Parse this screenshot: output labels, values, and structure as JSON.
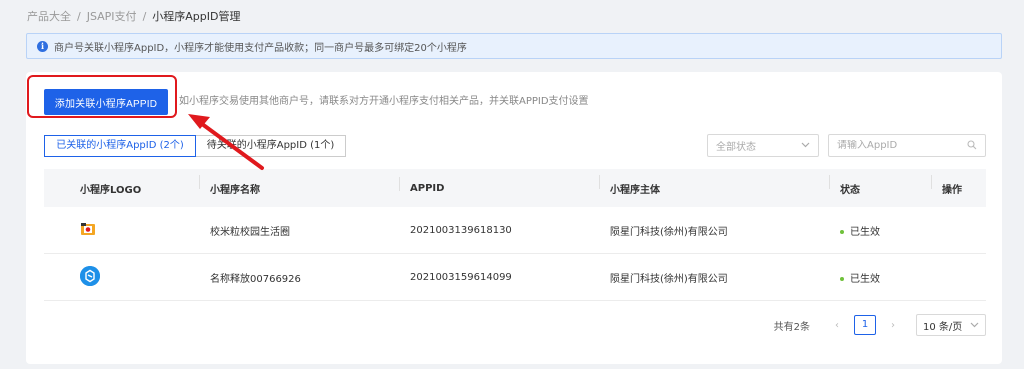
{
  "breadcrumb": [
    "产品大全",
    "JSAPI支付",
    "小程序AppID管理"
  ],
  "notice": "商户号关联小程序AppID，小程序才能使用支付产品收款；同一商户号最多可绑定20个小程序",
  "add_button": "添加关联小程序APPID",
  "add_hint": "如小程序交易使用其他商户号，请联系对方开通小程序支付相关产品，并关联APPID支付设置",
  "tabs": [
    "已关联的小程序AppID (2个)",
    "待关联的小程序AppID (1个)"
  ],
  "status_filter": "全部状态",
  "search_placeholder": "请输入AppID",
  "table": {
    "headers": [
      "小程序LOGO",
      "小程序名称",
      "APPID",
      "小程序主体",
      "状态",
      "操作"
    ],
    "rows": [
      {
        "name": "校米粒校园生活圈",
        "appid": "2021003139618130",
        "subject": "陨星门科技(徐州)有限公司",
        "status": "已生效"
      },
      {
        "name": "名称释放00766926",
        "appid": "2021003159614099",
        "subject": "陨星门科技(徐州)有限公司",
        "status": "已生效"
      }
    ]
  },
  "pagination": {
    "total": "共有2条",
    "current": "1",
    "page_size": "10 条/页"
  },
  "colors": {
    "primary": "#1e62e8",
    "highlight": "#e0191d",
    "success": "#6fc13b"
  }
}
